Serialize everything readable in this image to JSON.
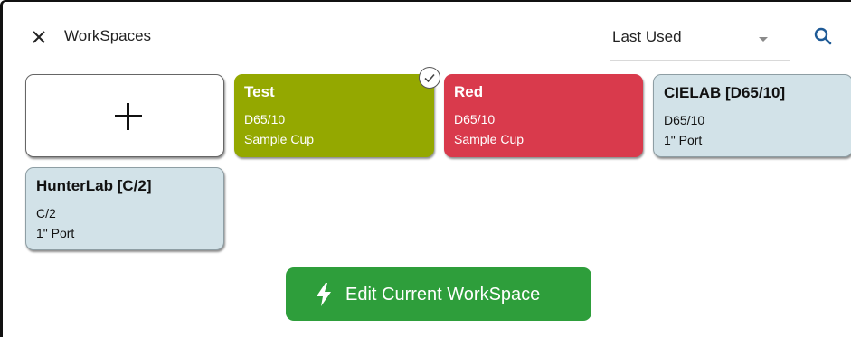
{
  "header": {
    "title": "WorkSpaces",
    "sort_value": "Last Used"
  },
  "icons": {
    "close": "close-icon",
    "search": "search-icon",
    "dropdown": "caret-down-icon",
    "add": "plus-icon",
    "selected": "check-icon",
    "edit": "lightning-bolt-icon"
  },
  "colors": {
    "test_card": "#94a800",
    "red_card": "#d93a4c",
    "neutral_card": "#d2e2e8",
    "action_button": "#2e9e3b",
    "search_icon": "#1e5a96"
  },
  "workspaces": [
    {
      "name": "Test",
      "illuminant": "D65/10",
      "accessory": "Sample Cup",
      "selected": true
    },
    {
      "name": "Red",
      "illuminant": "D65/10",
      "accessory": "Sample Cup",
      "selected": false
    },
    {
      "name": "CIELAB [D65/10]",
      "illuminant": "D65/10",
      "accessory": "1\" Port",
      "selected": false
    },
    {
      "name": "HunterLab [C/2]",
      "illuminant": "C/2",
      "accessory": "1\" Port",
      "selected": false
    }
  ],
  "actions": {
    "edit_label": "Edit Current WorkSpace"
  }
}
